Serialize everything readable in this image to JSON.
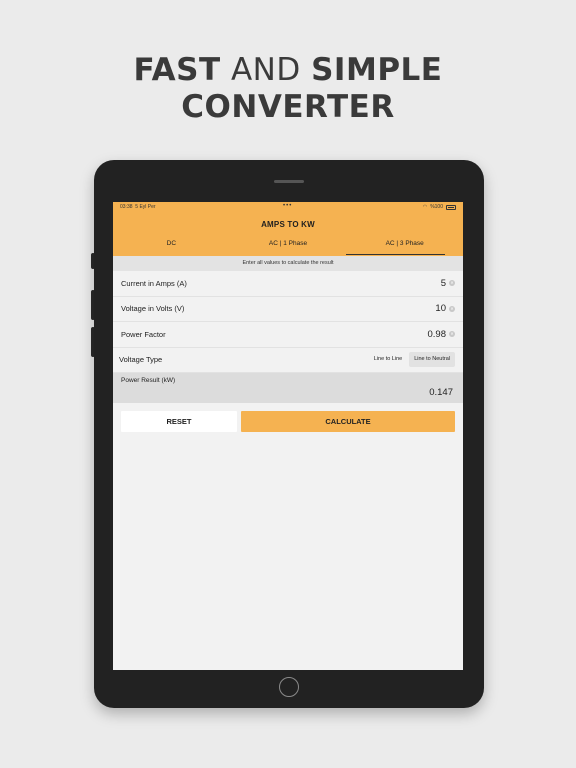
{
  "headline": {
    "word1": "FAST",
    "word2": "AND",
    "word3": "SIMPLE",
    "line2": "CONVERTER"
  },
  "status_bar": {
    "time": "03:38",
    "date": "5 Eyl Per",
    "dots": "•••",
    "battery": "%100"
  },
  "app": {
    "title": "AMPS TO KW",
    "tabs": [
      {
        "label": "DC",
        "active": false
      },
      {
        "label": "AC | 1 Phase",
        "active": false
      },
      {
        "label": "AC | 3 Phase",
        "active": true
      }
    ],
    "instruction": "Enter all values to calculate the result",
    "fields": [
      {
        "label": "Current in Amps (A)",
        "value": "5"
      },
      {
        "label": "Voltage in Volts (V)",
        "value": "10"
      },
      {
        "label": "Power Factor",
        "value": "0.98"
      }
    ],
    "voltage_type": {
      "label": "Voltage Type",
      "options": [
        "Line to Line",
        "Line to Neutral"
      ],
      "selected": "Line to Neutral"
    },
    "result": {
      "label": "Power Result (kW)",
      "value": "0.147"
    },
    "buttons": {
      "reset": "RESET",
      "calculate": "CALCULATE"
    }
  },
  "colors": {
    "accent": "#f5b251",
    "background": "#ebebeb",
    "device": "#222222"
  }
}
